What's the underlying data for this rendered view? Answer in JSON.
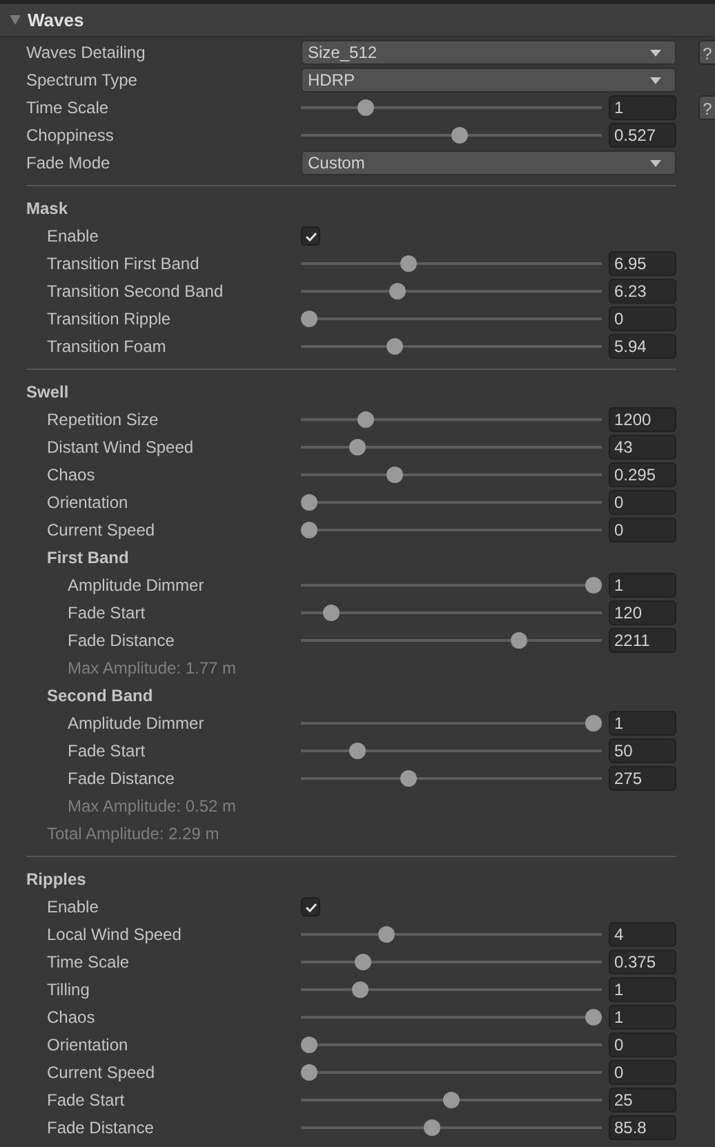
{
  "header": {
    "title": "Waves",
    "expanded": true
  },
  "items": [
    {
      "kind": "dropdown",
      "label": "Waves Detailing",
      "value": "Size_512",
      "help": "?"
    },
    {
      "kind": "dropdown",
      "label": "Spectrum Type",
      "value": "HDRP"
    },
    {
      "kind": "slider",
      "label": "Time Scale",
      "level": 0.2,
      "value": "1",
      "help": "?"
    },
    {
      "kind": "slider",
      "label": "Choppiness",
      "level": 0.53,
      "value": "0.527"
    },
    {
      "kind": "dropdown",
      "label": "Fade Mode",
      "value": "Custom"
    },
    {
      "kind": "heading",
      "label": "Mask",
      "children": [
        {
          "kind": "checkbox",
          "label": "Enable",
          "checked": true
        },
        {
          "kind": "slider",
          "label": "Transition First Band",
          "level": 0.35,
          "value": "6.95"
        },
        {
          "kind": "slider",
          "label": "Transition Second Band",
          "level": 0.31,
          "value": "6.23"
        },
        {
          "kind": "slider",
          "label": "Transition Ripple",
          "level": 0,
          "value": "0"
        },
        {
          "kind": "slider",
          "label": "Transition Foam",
          "level": 0.3,
          "value": "5.94"
        }
      ]
    },
    {
      "kind": "heading",
      "label": "Swell",
      "children": [
        {
          "kind": "slider",
          "label": "Repetition Size",
          "level": 0.2,
          "value": "1200"
        },
        {
          "kind": "slider",
          "label": "Distant Wind Speed",
          "level": 0.17,
          "value": "43"
        },
        {
          "kind": "slider",
          "label": "Chaos",
          "level": 0.3,
          "value": "0.295"
        },
        {
          "kind": "slider",
          "label": "Orientation",
          "level": 0,
          "value": "0"
        },
        {
          "kind": "slider",
          "label": "Current Speed",
          "level": 0,
          "value": "0"
        },
        {
          "kind": "heading",
          "label": "First Band",
          "children": [
            {
              "kind": "slider",
              "label": "Amplitude Dimmer",
              "level": 1,
              "value": "1"
            },
            {
              "kind": "slider",
              "label": "Fade Start",
              "level": 0.08,
              "value": "120"
            },
            {
              "kind": "slider",
              "label": "Fade Distance",
              "level": 0.74,
              "value": "2211"
            },
            {
              "kind": "note",
              "label": "Max Amplitude: 1.77 m"
            }
          ]
        },
        {
          "kind": "heading",
          "label": "Second Band",
          "children": [
            {
              "kind": "slider",
              "label": "Amplitude Dimmer",
              "level": 1,
              "value": "1"
            },
            {
              "kind": "slider",
              "label": "Fade Start",
              "level": 0.17,
              "value": "50"
            },
            {
              "kind": "slider",
              "label": "Fade Distance",
              "level": 0.35,
              "value": "275"
            },
            {
              "kind": "note",
              "label": "Max Amplitude: 0.52 m"
            }
          ]
        },
        {
          "kind": "note",
          "label": "Total Amplitude: 2.29 m"
        }
      ]
    },
    {
      "kind": "heading",
      "label": "Ripples",
      "children": [
        {
          "kind": "checkbox",
          "label": "Enable",
          "checked": true
        },
        {
          "kind": "slider",
          "label": "Local Wind Speed",
          "level": 0.27,
          "value": "4"
        },
        {
          "kind": "slider",
          "label": "Time Scale",
          "level": 0.19,
          "value": "0.375"
        },
        {
          "kind": "slider",
          "label": "Tilling",
          "level": 0.18,
          "value": "1"
        },
        {
          "kind": "slider",
          "label": "Chaos",
          "level": 1,
          "value": "1"
        },
        {
          "kind": "slider",
          "label": "Orientation",
          "level": 0,
          "value": "0"
        },
        {
          "kind": "slider",
          "label": "Current Speed",
          "level": 0,
          "value": "0"
        },
        {
          "kind": "slider",
          "label": "Fade Start",
          "level": 0.5,
          "value": "25"
        },
        {
          "kind": "slider",
          "label": "Fade Distance",
          "level": 0.43,
          "value": "85.8"
        }
      ]
    }
  ]
}
